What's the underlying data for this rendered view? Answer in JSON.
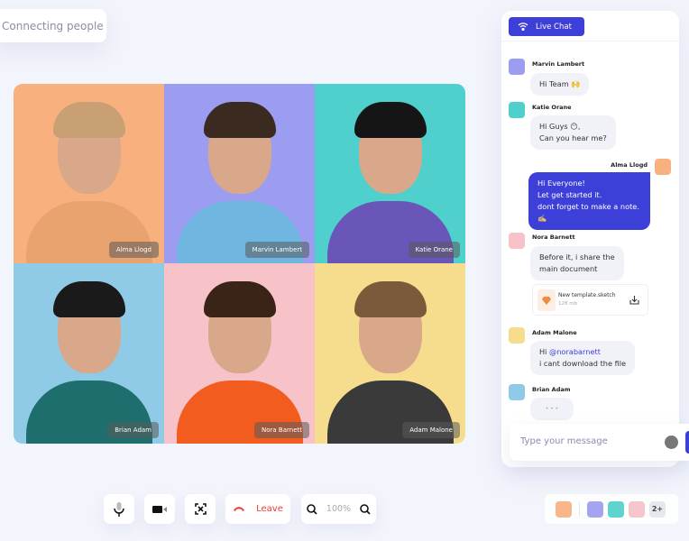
{
  "app": {
    "title": "Connecting people"
  },
  "participants": [
    {
      "name": "Alma Llogd",
      "bg": "#f9b07f",
      "shirt": "#e9a36f",
      "hair": "#c9a073"
    },
    {
      "name": "Marvin Lambert",
      "bg": "#9c9cf0",
      "shirt": "#6fb7e0",
      "hair": "#3a2a20"
    },
    {
      "name": "Katie Orane",
      "bg": "#4fd0cc",
      "shirt": "#6a55b8",
      "hair": "#151515"
    },
    {
      "name": "Brian Adam",
      "bg": "#8fcbe6",
      "shirt": "#1f6e6e",
      "hair": "#1a1a1a"
    },
    {
      "name": "Nora Barnett",
      "bg": "#f7c2c8",
      "shirt": "#f25c1e",
      "hair": "#3a2418"
    },
    {
      "name": "Adam Malone",
      "bg": "#f6dd8e",
      "shirt": "#3a3a3a",
      "hair": "#7a5a3a"
    }
  ],
  "controls": {
    "leave_label": "Leave",
    "zoom_level": "100%",
    "leave_color": "#f2373a"
  },
  "chat": {
    "header": "Live Chat",
    "accent": "#3d3fd9",
    "messages": [
      {
        "sender": "Marvin Lambert",
        "lines": [
          "Hi Team 🙌"
        ]
      },
      {
        "sender": "Katie Orane",
        "lines": [
          "Hi Guys 😶,",
          "Can you hear me?"
        ]
      },
      {
        "sender": "Alma Llogd",
        "lines": [
          "Hi Everyone!",
          "Let get started it.",
          "dont forget to make a note. ✍🏼"
        ]
      },
      {
        "sender": "Nora Barnett",
        "lines": [
          "Before it, i share the",
          "main document"
        ]
      },
      {
        "sender": "Adam Malone",
        "mention": "@norabarnett",
        "prefix": "Hi ",
        "lines": [
          "i cant download the file"
        ]
      },
      {
        "sender": "Brian Adam",
        "typing": "• • •"
      }
    ],
    "attachment": {
      "filename": "New template.sketch",
      "size": "128 mb"
    },
    "input_placeholder": "Type  your message"
  },
  "participants_bar": {
    "more": "2+"
  }
}
